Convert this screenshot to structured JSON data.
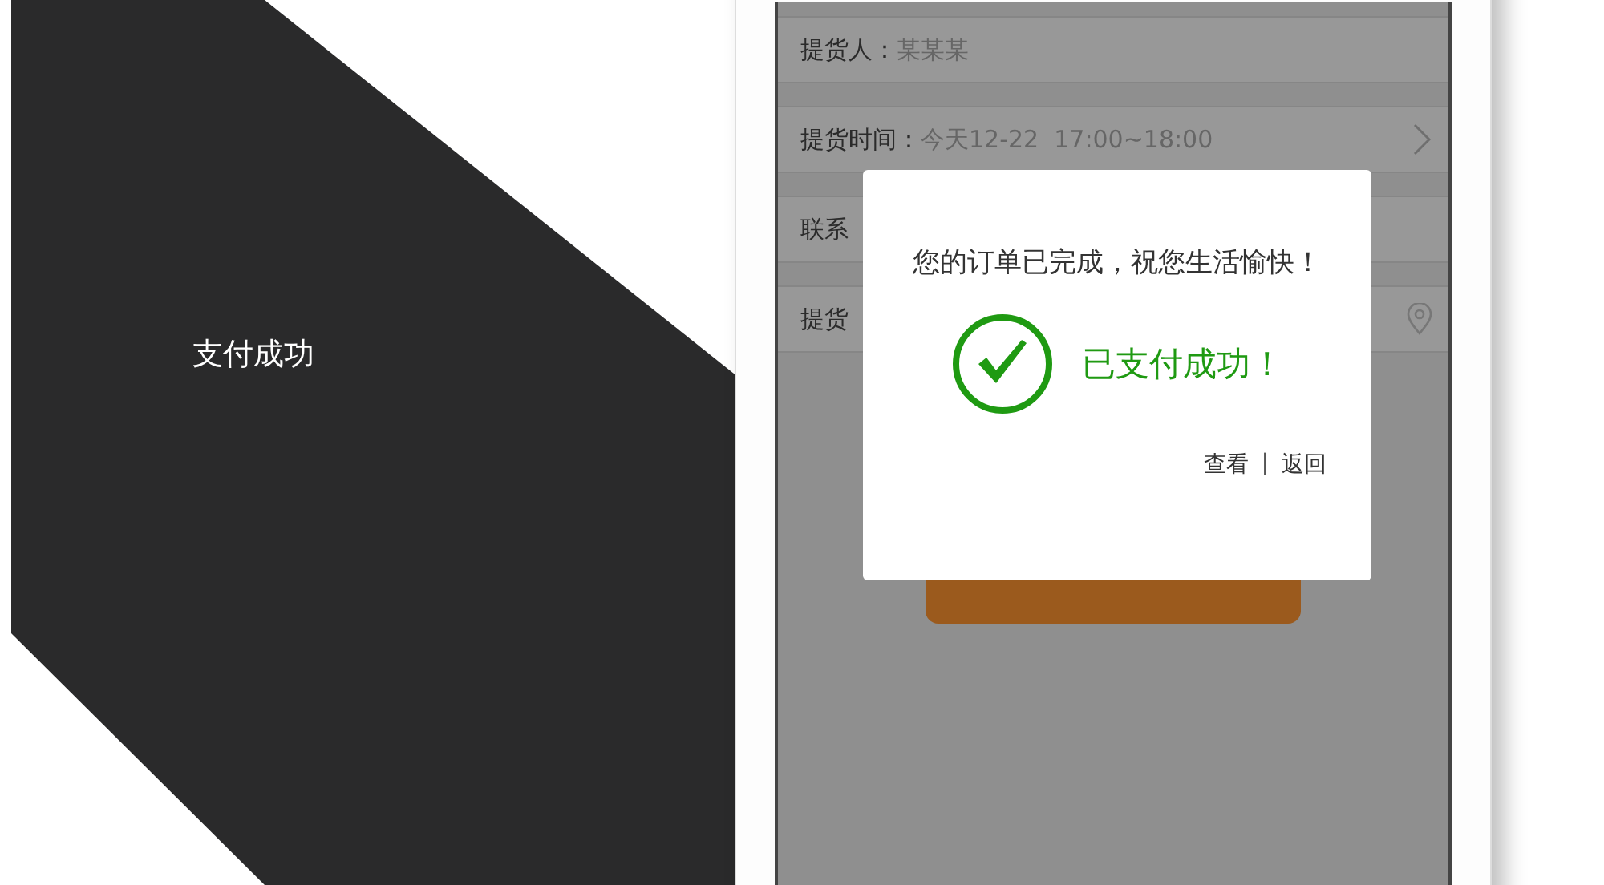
{
  "caption": "支付成功",
  "rows": [
    {
      "label": "提货人：",
      "value": "某某某",
      "kind": "plain"
    },
    {
      "label": "提货时间：",
      "value": "今天12-22  17:00~18:00",
      "kind": "arrow"
    },
    {
      "label": "联系",
      "kind": "plain"
    },
    {
      "label": "提货",
      "kind": "location"
    }
  ],
  "dialog": {
    "message": "您的订单已完成，祝您生活愉快！",
    "status": "已支付成功！",
    "actions": [
      "查看",
      "返回"
    ],
    "separator": "|"
  }
}
